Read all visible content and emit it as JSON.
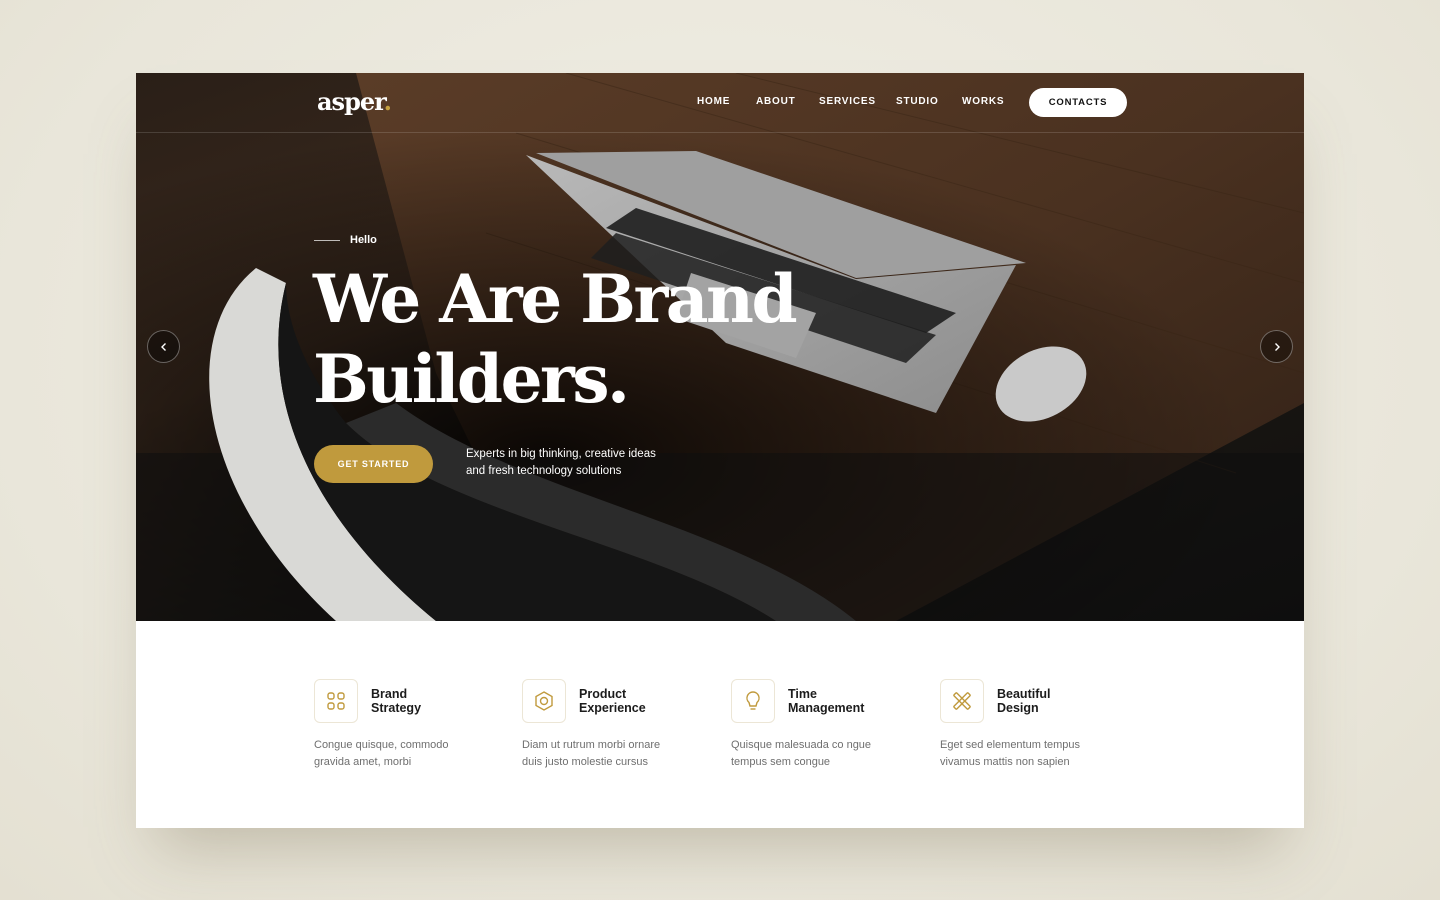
{
  "brand": {
    "name": "asper",
    "dot": ".",
    "accent_color": "#c09a3d"
  },
  "nav": {
    "items": [
      "HOME",
      "ABOUT",
      "SERVICES",
      "STUDIO",
      "WORKS"
    ],
    "contact_label": "CONTACTS"
  },
  "hero": {
    "eyebrow": "Hello",
    "headline_line1": "We Are Brand",
    "headline_line2": "Builders.",
    "cta_label": "GET STARTED",
    "tagline_line1": "Experts in big thinking, creative ideas",
    "tagline_line2": "and fresh technology solutions",
    "prev_icon": "chevron-left-icon",
    "next_icon": "chevron-right-icon"
  },
  "features": [
    {
      "icon": "strategy-nodes-icon",
      "title_line1": "Brand",
      "title_line2": "Strategy",
      "desc_line1": "Congue quisque, commodo",
      "desc_line2": "gravida amet, morbi"
    },
    {
      "icon": "product-cube-icon",
      "title_line1": "Product",
      "title_line2": "Experience",
      "desc_line1": "Diam ut rutrum morbi ornare",
      "desc_line2": "duis justo molestie cursus"
    },
    {
      "icon": "lightbulb-icon",
      "title_line1": "Time",
      "title_line2": "Management",
      "desc_line1": "Quisque malesuada co ngue",
      "desc_line2": "tempus sem congue"
    },
    {
      "icon": "design-tools-icon",
      "title_line1": "Beautiful",
      "title_line2": "Design",
      "desc_line1": "Eget sed elementum tempus",
      "desc_line2": "vivamus mattis non sapien"
    }
  ]
}
